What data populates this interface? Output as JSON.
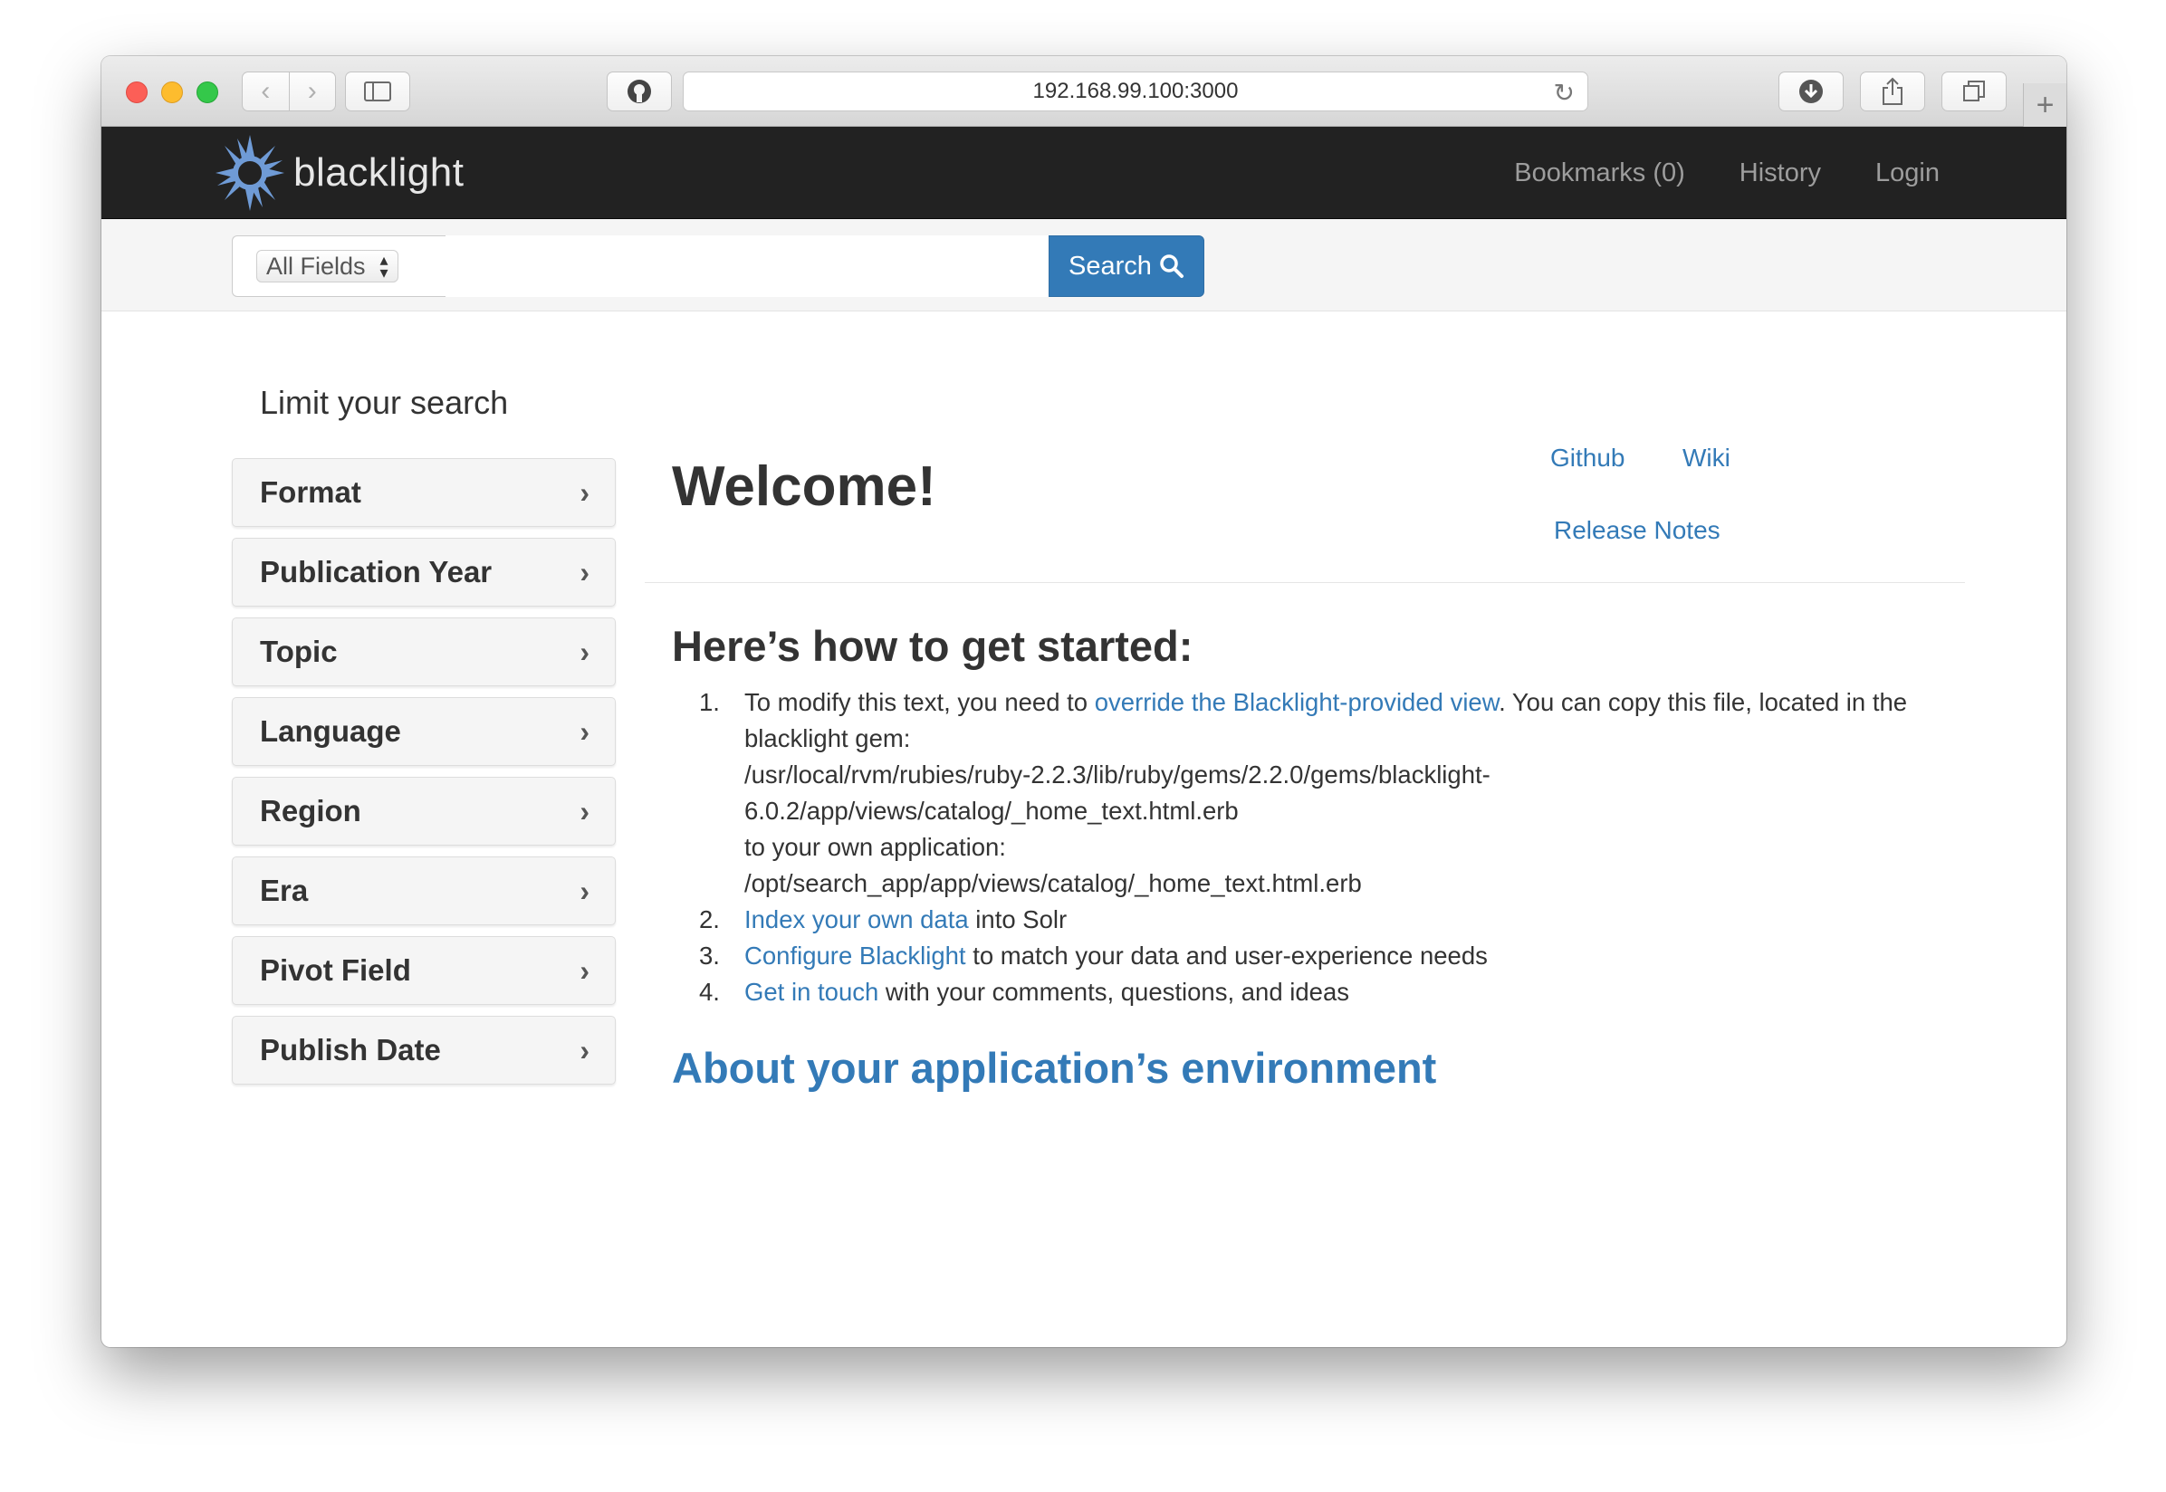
{
  "browser": {
    "url": "192.168.99.100:3000"
  },
  "navbar": {
    "brand": "blacklight",
    "links": [
      "Bookmarks (0)",
      "History",
      "Login"
    ]
  },
  "search": {
    "field_select": "All Fields",
    "query": "",
    "button_label": "Search"
  },
  "sidebar": {
    "title": "Limit your search",
    "facets": [
      "Format",
      "Publication Year",
      "Topic",
      "Language",
      "Region",
      "Era",
      "Pivot Field",
      "Publish Date"
    ]
  },
  "main": {
    "welcome": "Welcome!",
    "links": {
      "github": "Github",
      "wiki": "Wiki",
      "release_notes": "Release Notes"
    },
    "howto_title": "Here’s how to get started:",
    "steps": [
      {
        "num": "1.",
        "pre": "To modify this text, you need to ",
        "link": "override the Blacklight-provided view",
        "post": ". You can copy this file, located in the blacklight gem:",
        "path1a": "/usr/local/rvm/rubies/ruby-2.2.3/lib/ruby/gems/2.2.0/gems/blacklight-",
        "path1b": "6.0.2/app/views/catalog/_home_text.html.erb",
        "mid": "to your own application:",
        "path2": "/opt/search_app/app/views/catalog/_home_text.html.erb"
      },
      {
        "num": "2.",
        "link": "Index your own data",
        "post": " into Solr"
      },
      {
        "num": "3.",
        "link": "Configure Blacklight",
        "post": " to match your data and user-experience needs"
      },
      {
        "num": "4.",
        "link": "Get in touch",
        "post": " with your comments, questions, and ideas"
      }
    ],
    "about_link": "About your application’s environment"
  },
  "colors": {
    "navbar_bg": "#222222",
    "link": "#337ab7",
    "search_button": "#337ab7"
  }
}
